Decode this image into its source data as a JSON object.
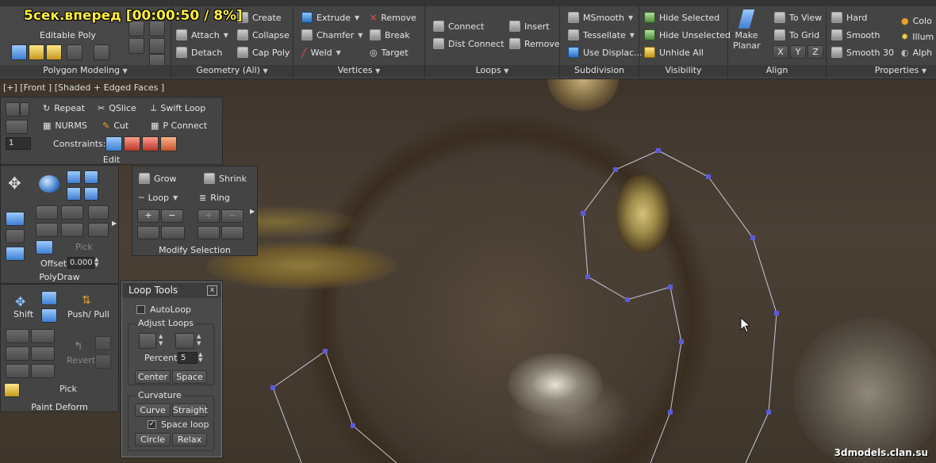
{
  "overlay": {
    "speed_text": "5сек.вперед [00:00:50 / 8%]",
    "watermark": "3dmodels.clan.su"
  },
  "ribbon": {
    "polygon_modeling": {
      "mode_label": "Editable Poly",
      "title": "Polygon Modeling"
    },
    "geometry": {
      "title": "Geometry (All)",
      "create": "Create",
      "attach": "Attach",
      "collapse": "Collapse",
      "detach": "Detach",
      "cap_poly": "Cap Poly"
    },
    "vertices": {
      "title": "Vertices",
      "extrude": "Extrude",
      "remove": "Remove",
      "chamfer": "Chamfer",
      "break": "Break",
      "weld": "Weld",
      "target": "Target"
    },
    "loops": {
      "title": "Loops",
      "connect": "Connect",
      "insert": "Insert",
      "dist_connect": "Dist Connect",
      "remove": "Remove"
    },
    "subdivision": {
      "title": "Subdivision",
      "msmooth": "MSmooth",
      "tessellate": "Tessellate",
      "use_displac": "Use Displac..."
    },
    "visibility": {
      "title": "Visibility",
      "hide_selected": "Hide Selected",
      "hide_unselected": "Hide Unselected",
      "unhide_all": "Unhide All"
    },
    "align": {
      "title": "Align",
      "make_planar": "Make\nPlanar",
      "make_planar_1": "Make",
      "make_planar_2": "Planar",
      "to_view": "To View",
      "to_grid": "To Grid",
      "x": "X",
      "y": "Y",
      "z": "Z"
    },
    "properties": {
      "title": "Properties",
      "hard": "Hard",
      "smooth": "Smooth",
      "smooth30": "Smooth 30",
      "color": "Colo",
      "illum": "Illum",
      "alpha": "Alph"
    }
  },
  "viewport": {
    "label": "[+] [Front ] [Shaded + Edged Faces ]"
  },
  "edit_panel": {
    "repeat": "Repeat",
    "qslice": "QSlice",
    "swift_loop": "Swift Loop",
    "nurms": "NURMS",
    "cut": "Cut",
    "p_connect": "P Connect",
    "constraints": "Constraints:",
    "title": "Edit",
    "spinner_value": "1"
  },
  "modify_selection": {
    "grow": "Grow",
    "shrink": "Shrink",
    "loop": "Loop",
    "ring": "Ring",
    "title": "Modify Selection"
  },
  "polydraw": {
    "pick": "Pick",
    "offset_label": "Offset:",
    "offset_value": "0.000",
    "title": "PolyDraw"
  },
  "paint_deform": {
    "shift": "Shift",
    "push_pull": "Push/ Pull",
    "revert": "Revert",
    "pick": "Pick",
    "title": "Paint Deform"
  },
  "loop_tools": {
    "title": "Loop Tools",
    "close": "x",
    "autoloop": "AutoLoop",
    "adjust_loops": "Adjust Loops",
    "percent_label": "Percent:",
    "percent_value": "5",
    "center": "Center",
    "space": "Space",
    "curvature": "Curvature",
    "curve": "Curve",
    "straight": "Straight",
    "space_loop": "Space loop",
    "circle": "Circle",
    "relax": "Relax"
  },
  "colors": {
    "vertex": "#5b5bd8",
    "edge": "#c8c8d8",
    "speed_text": "#ffef3a",
    "panel_bg": "#444444"
  }
}
